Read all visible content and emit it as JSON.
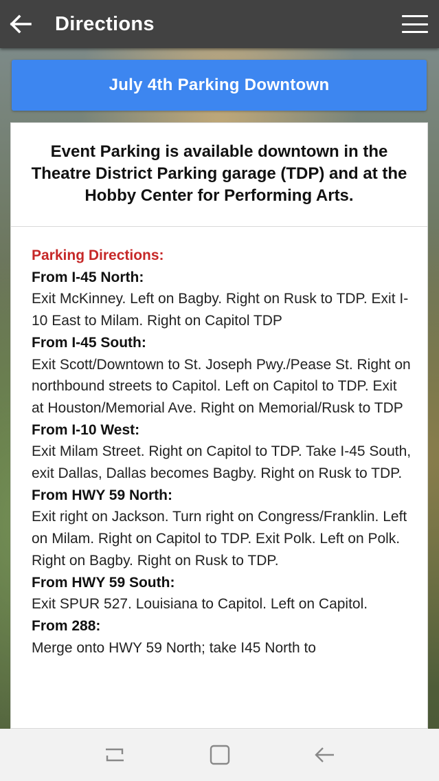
{
  "header": {
    "title": "Directions",
    "back_icon": "arrow-left-icon",
    "menu_icon": "hamburger-menu-icon"
  },
  "banner": {
    "label": "July 4th Parking Downtown",
    "color": "#3d86f0"
  },
  "info": {
    "headline": "Event Parking is available downtown in the Theatre District Parking garage (TDP) and at the Hobby Center for Performing Arts."
  },
  "directions": {
    "section_title": "Parking Directions:",
    "routes": [
      {
        "heading": "From I-45 North:",
        "text": "Exit McKinney. Left on Bagby. Right on Rusk to TDP. Exit I-10 East to Milam. Right on Capitol TDP"
      },
      {
        "heading": "From I-45 South:",
        "text": "Exit Scott/Downtown to St. Joseph Pwy./Pease St. Right on northbound streets to Capitol. Left on Capitol to TDP. Exit at Houston/Memorial Ave. Right on Memorial/Rusk to TDP"
      },
      {
        "heading": "From I-10 West:",
        "text": "Exit Milam Street. Right on Capitol to TDP. Take I-45 South, exit Dallas, Dallas becomes Bagby. Right on Rusk to TDP."
      },
      {
        "heading": "From HWY 59 North:",
        "text": "Exit right on Jackson. Turn right on Congress/Franklin. Left on Milam. Right on Capitol to TDP. Exit Polk. Left on Polk. Right on Bagby. Right on Rusk to TDP."
      },
      {
        "heading": "From HWY 59 South:",
        "text": "Exit SPUR 527. Louisiana to Capitol. Left on Capitol."
      },
      {
        "heading": "From 288:",
        "text": "Merge onto HWY 59 North; take I45 North to"
      }
    ]
  },
  "system_nav": {
    "recents_icon": "recent-apps-icon",
    "home_icon": "home-square-icon",
    "back_icon": "back-arrow-icon"
  }
}
